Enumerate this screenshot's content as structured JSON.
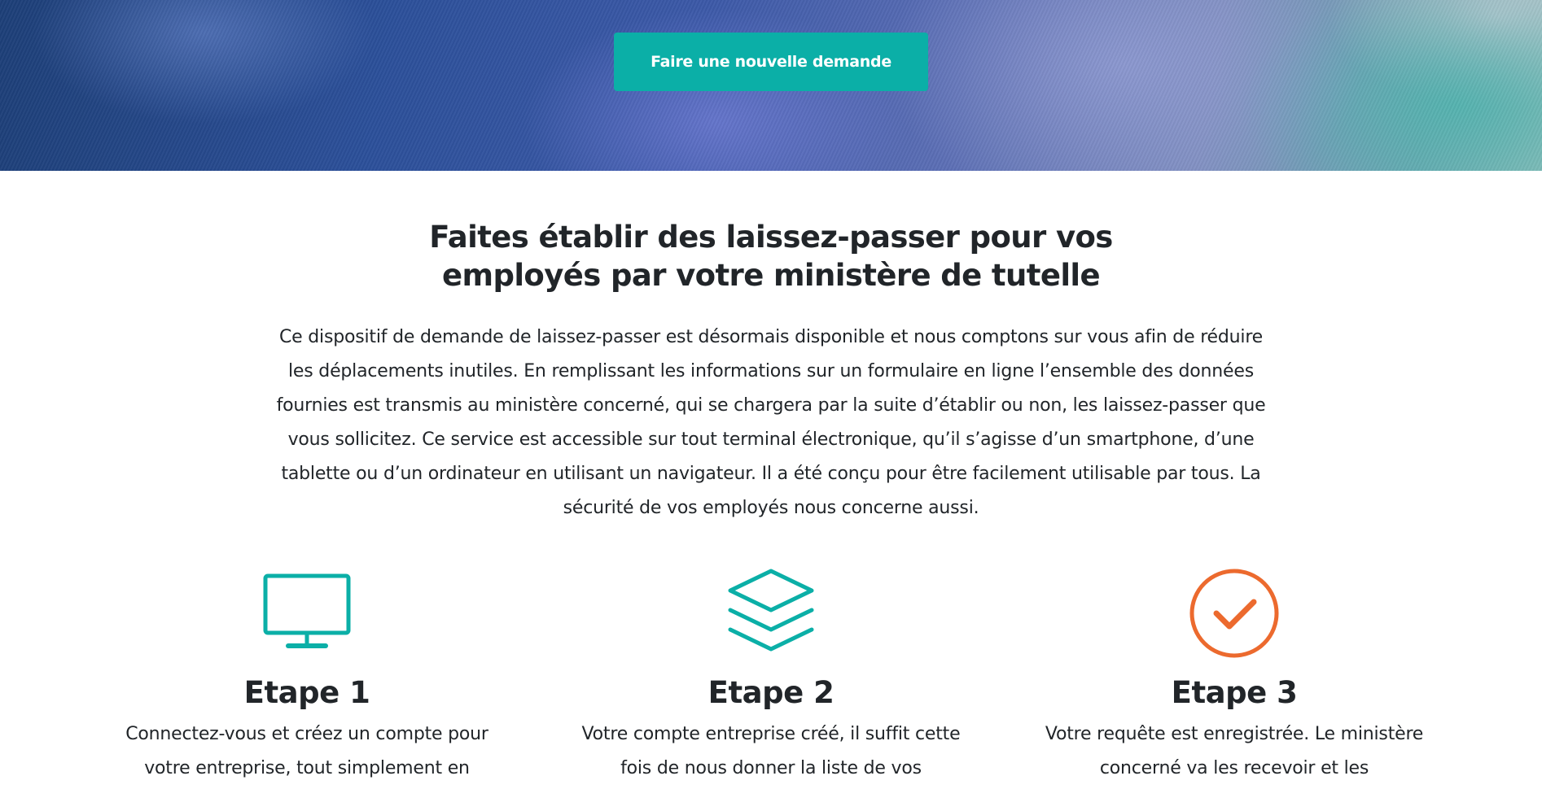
{
  "hero": {
    "cta_label": "Faire une nouvelle demande"
  },
  "intro": {
    "title": "Faites établir des laissez-passer pour vos employés par votre ministère de tutelle",
    "body": "Ce dispositif de demande de laissez-passer est désormais disponible et nous comptons sur vous afin de réduire les déplacements inutiles. En remplissant les informations sur un formulaire en ligne l’ensemble des données fournies est transmis au ministère concerné, qui se chargera par la suite d’établir ou non, les laissez-passer que vous sollicitez. Ce service est accessible sur tout terminal électronique, qu’il s’agisse d’un smartphone, d’une tablette ou d’un ordinateur en utilisant un navigateur. Il a été conçu pour être facilement utilisable par tous. La sécurité de vos employés nous concerne aussi."
  },
  "steps": [
    {
      "icon": "monitor-icon",
      "title": "Etape 1",
      "text": "Connectez-vous et créez un compte pour votre entreprise, tout simplement en"
    },
    {
      "icon": "layers-icon",
      "title": "Etape 2",
      "text": "Votre compte entreprise créé, il suffit cette fois de nous donner la liste de vos"
    },
    {
      "icon": "check-circle-icon",
      "title": "Etape 3",
      "text": "Votre requête est enregistrée. Le ministère concerné va les recevoir et les"
    }
  ],
  "colors": {
    "accent": "#0bafa7",
    "success": "#ec6a2e",
    "text": "#212529"
  }
}
